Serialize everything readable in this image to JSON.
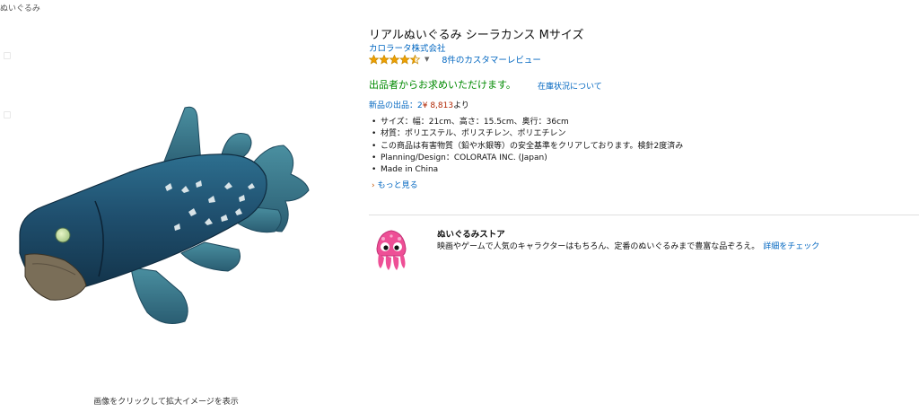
{
  "breadcrumb": "ぬいぐるみ",
  "product": {
    "title": "リアルぬいぐるみ シーラカンス Mサイズ",
    "brand": "カロラータ株式会社",
    "rating": {
      "stars": 4.5,
      "review_link": "8件のカスタマーレビュー"
    },
    "availability": "出品者からお求めいただけます。",
    "stock_link": "在庫状況について",
    "new_offers": {
      "prefix": "新品の出品：2",
      "price": "¥ 8,813",
      "suffix": "より"
    },
    "features": [
      "サイズ：幅：21cm、高さ：15.5cm、奥行：36cm",
      "材質：ポリエステル、ポリスチレン、ポリエチレン",
      "この商品は有害物質（鉛や水銀等）の安全基準をクリアしております。検針2度済み",
      "Planning/Design：COLORATA INC. (Japan)",
      "Made in China"
    ],
    "more_link": "もっと見る",
    "image_caption": "画像をクリックして拡大イメージを表示"
  },
  "store": {
    "name": "ぬいぐるみストア",
    "description": "映画やゲームで人気のキャラクターはもちろん、定番のぬいぐるみまで豊富な品ぞろえ。",
    "detail_link": "詳細をチェック"
  },
  "colors": {
    "link": "#0066c0",
    "price": "#b12704",
    "availability": "#008a00",
    "star": "#f0a000"
  }
}
